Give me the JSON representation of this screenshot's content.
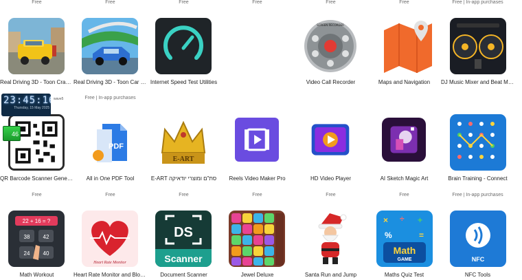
{
  "row1_prices": [
    "Free",
    "Free",
    "Free",
    "Free",
    "Free",
    "Free",
    "Free | In-app purchases"
  ],
  "row1_apps": [
    {
      "name": "Real Driving 3D - Toon Crazy T...",
      "icon": "taxi-game-icon"
    },
    {
      "name": "Real Driving 3D - Toon Car Stu...",
      "icon": "car-stunt-icon"
    },
    {
      "name": "Internet Speed Test Utilities",
      "icon": "speedometer-icon"
    },
    {
      "name": "",
      "icon": ""
    },
    {
      "name": "Video Call Recorder",
      "icon": "recorder-dial-icon"
    },
    {
      "name": "Maps and Navigation",
      "icon": "map-pin-icon"
    },
    {
      "name": "DJ Music Mixer and Beat Maker",
      "icon": "dj-turntable-icon"
    }
  ],
  "row2_prices": [
    "",
    "Free | In-app purchases",
    "Free",
    "Free",
    "Free",
    "Free",
    "Free"
  ],
  "row2_apps": [
    {
      "name": "QR Barcode Scanner Generator",
      "icon": "qr-code-icon"
    },
    {
      "name": "All in One PDF Tool",
      "icon": "pdf-icon"
    },
    {
      "name": "E-ART סת\"ם ומוצרי יודאיקה",
      "icon": "crown-icon"
    },
    {
      "name": "Reels Video Maker Pro",
      "icon": "video-maker-icon"
    },
    {
      "name": "HD Video Player",
      "icon": "film-play-icon"
    },
    {
      "name": "AI Sketch Magic Art",
      "icon": "sketch-art-icon"
    },
    {
      "name": "Brain Training - Connect",
      "icon": "connect-dots-icon"
    }
  ],
  "row3_prices": [
    "Free",
    "Free",
    "Free",
    "Free",
    "Free",
    "Free",
    "Free | In-app purchases"
  ],
  "row3_apps": [
    {
      "name": "Math Workout",
      "icon": "math-workout-icon"
    },
    {
      "name": "Heart Rate Monitor and Blood ...",
      "icon": "heart-rate-icon"
    },
    {
      "name": "Document Scanner",
      "icon": "document-scanner-icon"
    },
    {
      "name": "Jewel Deluxe",
      "icon": "jewel-icon"
    },
    {
      "name": "Santa Run and Jump",
      "icon": "santa-icon"
    },
    {
      "name": "Maths Quiz Test",
      "icon": "math-quiz-icon"
    },
    {
      "name": "NFC Tools",
      "icon": "nfc-icon"
    }
  ],
  "overlay": {
    "time": "23:45:16",
    "date": "Thursday, 15 May 2025",
    "battery": "46",
    "side_text": "wave5"
  },
  "icon_text": {
    "pdf": "PDF",
    "eart": "E-ART",
    "heart_caption": "Heart Rate Monitor",
    "ds": "DS",
    "scanner": "Scanner",
    "math": "Math",
    "game": "GAME",
    "nfc": "NFC",
    "math_eq": "22 + 16 = ?",
    "math_a": "38",
    "math_b": "42",
    "math_c": "24",
    "math_d": "40",
    "recorder": "SCREEN RECORDER"
  }
}
